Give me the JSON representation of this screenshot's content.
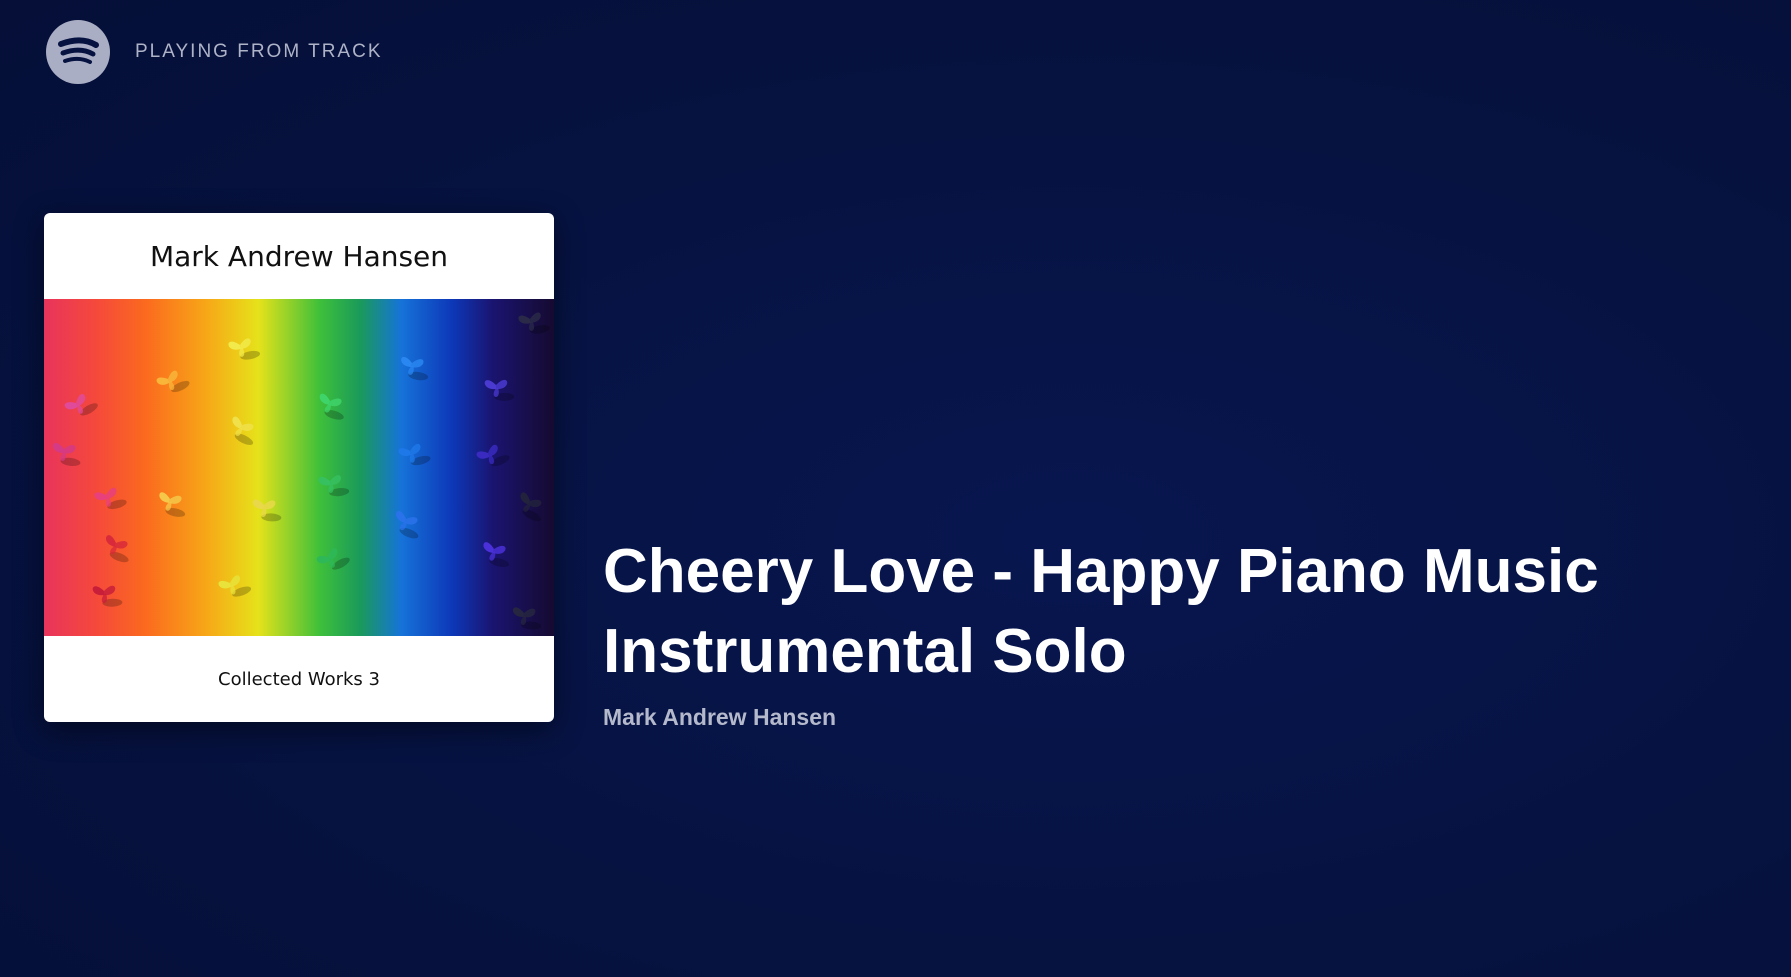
{
  "header": {
    "logo_icon": "spotify-logo-icon",
    "context_label": "PLAYING FROM TRACK"
  },
  "cover": {
    "artist_text": "Mark Andrew Hansen",
    "album_text": "Collected Works 3"
  },
  "track": {
    "title": "Cheery Love - Happy Piano Music Instrumental Solo",
    "artist": "Mark Andrew Hansen"
  },
  "colors": {
    "background": "#061240",
    "title_text": "#ffffff",
    "secondary_text": "#b4b9cc",
    "logo_bg": "#a9aec4"
  }
}
